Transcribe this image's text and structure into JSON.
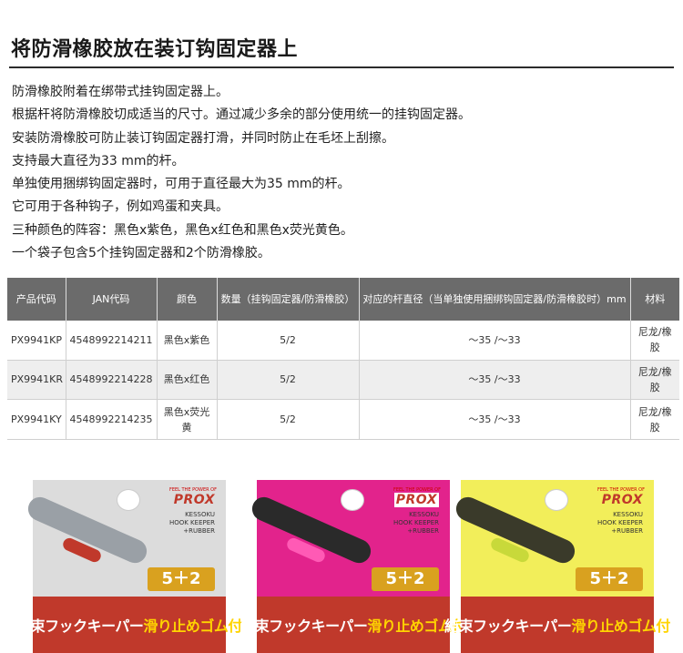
{
  "heading": "将防滑橡胶放在装订钩固定器上",
  "description": [
    "防滑橡胶附着在绑带式挂钩固定器上。",
    "根据杆将防滑橡胶切成适当的尺寸。通过减少多余的部分使用统一的挂钩固定器。",
    "安装防滑橡胶可防止装订钩固定器打滑，并同时防止在毛坯上刮擦。",
    "支持最大直径为33 mm的杆。",
    "单独使用捆绑钩固定器时，可用于直径最大为35 mm的杆。",
    "它可用于各种钩子，例如鸡蛋和夹具。",
    "三种颜色的阵容：黑色x紫色，黑色x红色和黑色x荧光黄色。",
    "一个袋子包含5个挂钩固定器和2个防滑橡胶。"
  ],
  "table": {
    "headers": [
      "产品代码",
      "JAN代码",
      "颜色",
      "数量（挂钩固定器/防滑橡胶）",
      "对应的杆直径（当单独使用捆绑钩固定器/防滑橡胶时）mm",
      "材料"
    ],
    "rows": [
      [
        "PX9941KP",
        "4548992214211",
        "黑色x紫色",
        "5/2",
        "～35 /～33",
        "尼龙/橡胶"
      ],
      [
        "PX9941KR",
        "4548992214228",
        "黑色x红色",
        "5/2",
        "～35 /～33",
        "尼龙/橡胶"
      ],
      [
        "PX9941KY",
        "4548992214235",
        "黑色x荧光黄",
        "5/2",
        "～35 /～33",
        "尼龙/橡胶"
      ]
    ]
  },
  "packages": [
    {
      "variant": "purple",
      "bg": "#dcdcdc",
      "band": "#c0392b",
      "label_bg": "#c0392b"
    },
    {
      "variant": "red",
      "bg": "#e2238c",
      "band": "#e2238c",
      "label_bg": "#c0392b"
    },
    {
      "variant": "yellow",
      "bg": "#f2ee5a",
      "band": "#c8d93a",
      "label_bg": "#c0392b"
    }
  ],
  "package_text": {
    "brand_tag": "FEEL THE POWER OF",
    "brand": "PROX",
    "subtitle_1": "KESSOKU",
    "subtitle_2": "HOOK KEEPER",
    "subtitle_3": "+RUBBER",
    "count": "5＋2",
    "label_main": "結束フックキーパー",
    "label_highlight": "滑り止めゴム付"
  }
}
